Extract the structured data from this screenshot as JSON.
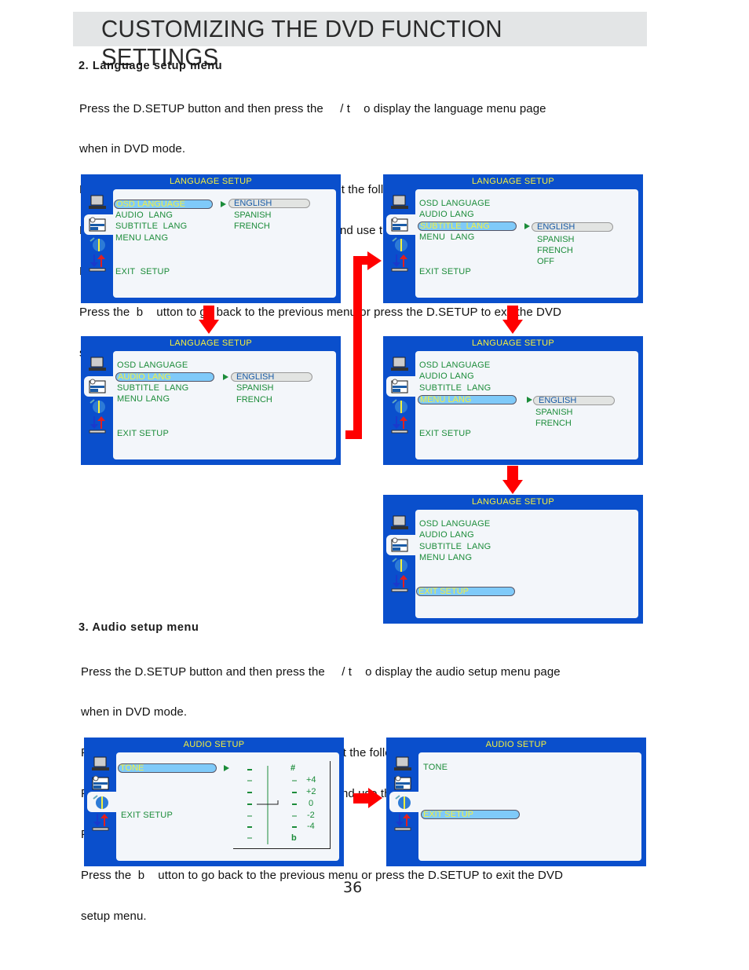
{
  "page_title": "CUSTOMIZING THE DVD FUNCTION SETTINGS",
  "page_number": "36",
  "section_language": {
    "heading_num": "2",
    "heading_text": ". Language  setup  menu",
    "lines": [
      "Press the D.SETUP button and then press the     / t    o display the language menu page",
      "when in DVD mode.",
      "Press the  b    utton to move the highlight to select the following option.",
      "Press the  b    utton to enter the following menu and use the     / b    utton to select a menu item.",
      "Press the ENTER button to cnfirm.",
      "Press the  b    utton to go back to the previous menu or press the D.SETUP to exit the DVD",
      "setup menu."
    ]
  },
  "section_audio": {
    "heading_num": "3",
    "heading_text": ". Audio  setup  menu",
    "lines": [
      "Press the D.SETUP button and then press the     / t    o display the audio setup menu page",
      "when in DVD mode.",
      "Press the  b    utton to move the highlight to select the following option.",
      "Press the  b    utton to enter the following menu and use the     / b    utton to select a menu item.",
      "Press the ENTER button to cnfirm.",
      "Press the  b    utton to go back to the previous menu or press the D.SETUP to exit the DVD",
      "setup menu."
    ]
  },
  "lang_screens": {
    "title": "LANGUAGE  SETUP",
    "title2": "LANGUAGE SETUP",
    "items": [
      "OSD LANGUAGE",
      "AUDIO  LANG",
      "SUBTITLE  LANG",
      "MENU LANG",
      "EXIT  SETUP"
    ],
    "items_alt": [
      "OSD LANGUAGE",
      "AUDIO LANG",
      "SUBTITLE  LANG",
      "MENU  LANG",
      "EXIT SETUP"
    ],
    "options3": [
      "ENGLISH",
      "SPANISH",
      "FRENCH"
    ],
    "options4": [
      "ENGLISH",
      "SPANISH",
      "FRENCH",
      "OFF"
    ]
  },
  "audio_screens": {
    "title": "AUDIO SETUP",
    "items": [
      "TONE",
      "EXIT SETUP"
    ],
    "tone_top_symbol": "#",
    "tone_bottom_symbol": "b",
    "tone_levels": [
      "+4",
      "+2",
      "0",
      "-2",
      "-4"
    ],
    "tone_value": "0"
  },
  "colors": {
    "screen_bg": "#0a4fcc",
    "title_yellow": "#f5f03c",
    "item_green": "#1c8c3a",
    "highlight": "#7fcaf9",
    "arrow_red": "#ff0000"
  }
}
